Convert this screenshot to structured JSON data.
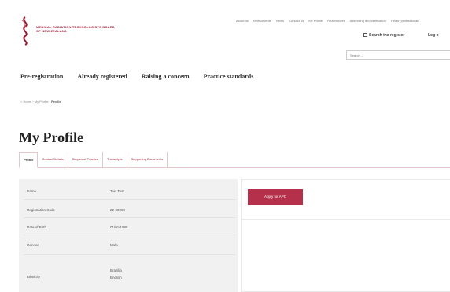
{
  "header": {
    "logo_lines": [
      "MEDICAL RADIATION TECHNOLOGISTS BOARD",
      "OF NEW ZEALAND"
    ],
    "top_links": [
      "About us",
      "News/events",
      "News",
      "Contact us",
      "My Profile",
      "Health notes",
      "Assessing and verification",
      "Health professionals"
    ],
    "search_register_label": "Search the register",
    "login_label": "Log o",
    "search_placeholder": "Search..."
  },
  "nav": {
    "items": [
      "Pre-registration",
      "Already registered",
      "Raising a concern",
      "Practice standards"
    ]
  },
  "breadcrumb": {
    "items": [
      "Home",
      "My Profile"
    ],
    "current": "Profile"
  },
  "page_title": "My Profile",
  "tabs": [
    "Profile",
    "Contact Details",
    "Scopes of Practice",
    "Transcripts",
    "Supporting Documents"
  ],
  "profile": {
    "rows": [
      {
        "label": "Name",
        "value": "Test Test"
      },
      {
        "label": "Registration Code",
        "value": "22-00000"
      },
      {
        "label": "Date of Birth",
        "value": "01/01/1988"
      },
      {
        "label": "Gender",
        "value": "Male"
      },
      {
        "label": "Ethnicity",
        "value": "Brazilia\nEnglish"
      }
    ]
  },
  "actions": {
    "apply_label": "Apply for APC"
  },
  "colors": {
    "brand": "#9b1c34",
    "button": "#b5304a"
  }
}
